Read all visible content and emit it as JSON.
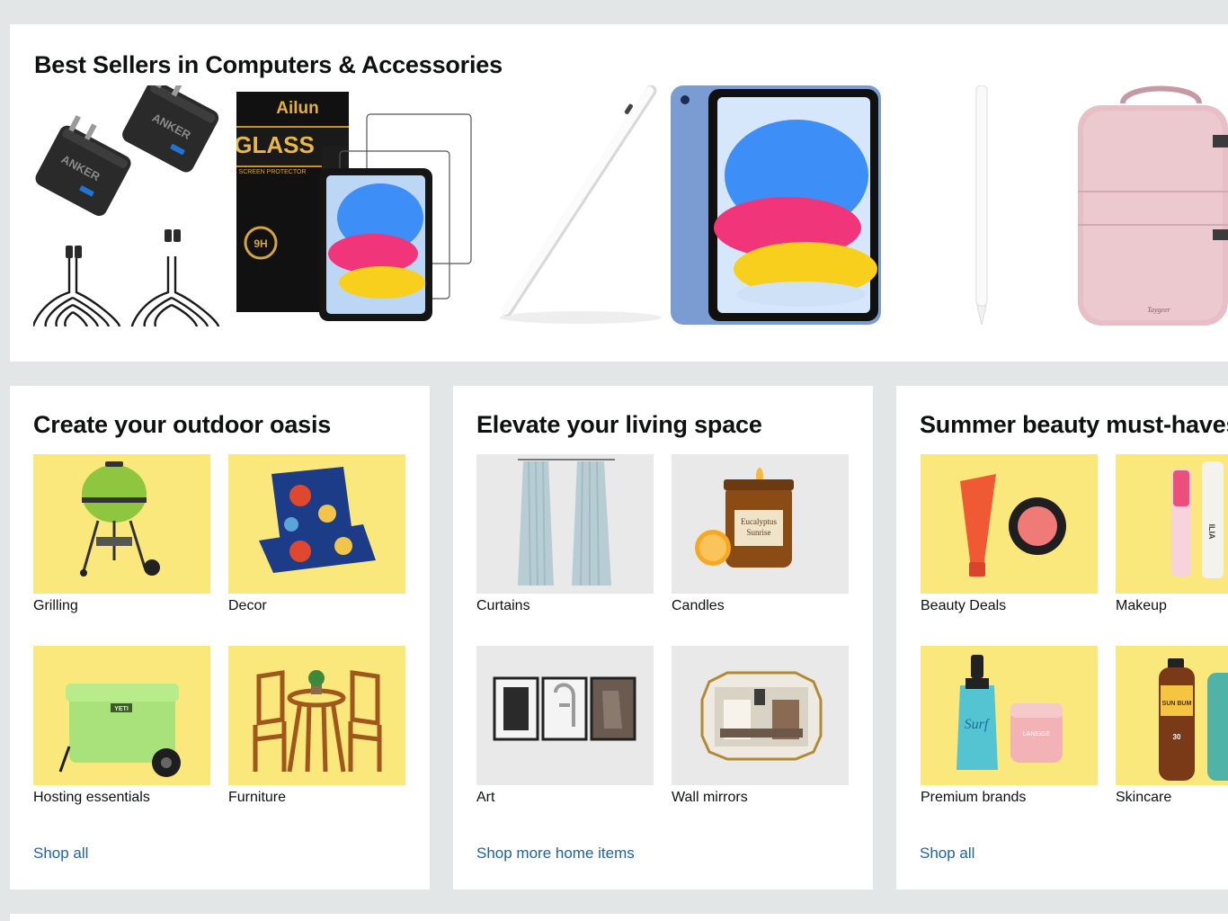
{
  "best_sellers": {
    "title": "Best Sellers in Computers & Accessories",
    "products": [
      {
        "icon": "usb-charger-icon",
        "brand": "ANKER"
      },
      {
        "icon": "screen-protector-icon",
        "brand": "Ailun",
        "box_text": "GLASS",
        "box_subtext": "SCREEN PROTECTOR"
      },
      {
        "icon": "stylus-pen-icon"
      },
      {
        "icon": "tablet-icon"
      },
      {
        "icon": "pencil-icon"
      },
      {
        "icon": "backpack-icon",
        "brand": "Taygeer"
      }
    ]
  },
  "cards": [
    {
      "title": "Create your outdoor oasis",
      "tiles": [
        {
          "label": "Grilling",
          "icon": "grill-icon"
        },
        {
          "label": "Decor",
          "icon": "pillows-icon"
        },
        {
          "label": "Hosting essentials",
          "icon": "cooler-icon",
          "brand": "YETI"
        },
        {
          "label": "Furniture",
          "icon": "bistro-set-icon"
        }
      ],
      "link": "Shop all"
    },
    {
      "title": "Elevate your living space",
      "tiles": [
        {
          "label": "Curtains",
          "icon": "curtains-icon"
        },
        {
          "label": "Candles",
          "icon": "candle-icon",
          "jar_text_1": "Eucalyptus",
          "jar_text_2": "Sunrise"
        },
        {
          "label": "Art",
          "icon": "wall-art-icon"
        },
        {
          "label": "Wall mirrors",
          "icon": "mirror-icon"
        }
      ],
      "link": "Shop more home items"
    },
    {
      "title": "Summer beauty must-haves",
      "tiles": [
        {
          "label": "Beauty Deals",
          "icon": "blush-compact-icon"
        },
        {
          "label": "Makeup",
          "icon": "lip-gloss-icon",
          "brand": "ILIA"
        },
        {
          "label": "Premium brands",
          "icon": "hair-spray-icon",
          "brand": "LANEIGE",
          "script_text": "Surf"
        },
        {
          "label": "Skincare",
          "icon": "sunscreen-icon",
          "brand": "SUN BUM",
          "spf": "30"
        }
      ],
      "link": "Shop all"
    }
  ],
  "colors": {
    "page_bg": "#e3e6e6",
    "card_bg": "#ffffff",
    "tile_yellow": "#fbe87d",
    "tile_gray": "#e9e9e9",
    "link": "#2162a1",
    "text": "#0f1111"
  }
}
